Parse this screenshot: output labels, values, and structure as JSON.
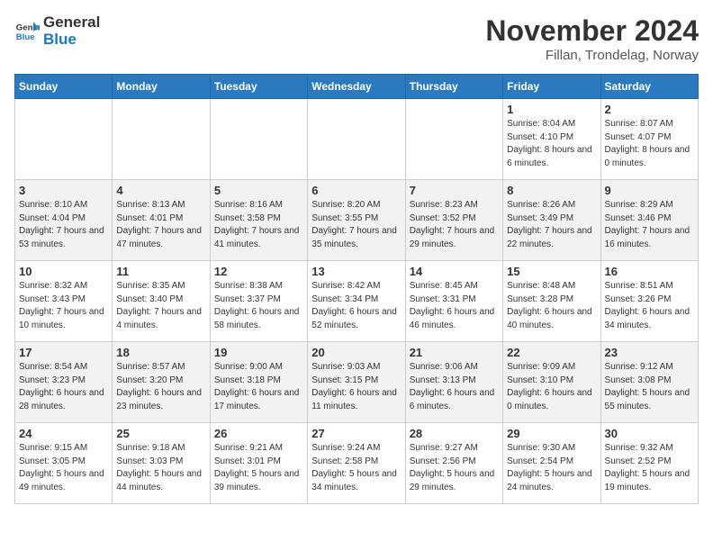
{
  "header": {
    "logo_general": "General",
    "logo_blue": "Blue",
    "month": "November 2024",
    "location": "Fillan, Trondelag, Norway"
  },
  "days_of_week": [
    "Sunday",
    "Monday",
    "Tuesday",
    "Wednesday",
    "Thursday",
    "Friday",
    "Saturday"
  ],
  "weeks": [
    [
      {
        "day": "",
        "info": ""
      },
      {
        "day": "",
        "info": ""
      },
      {
        "day": "",
        "info": ""
      },
      {
        "day": "",
        "info": ""
      },
      {
        "day": "",
        "info": ""
      },
      {
        "day": "1",
        "info": "Sunrise: 8:04 AM\nSunset: 4:10 PM\nDaylight: 8 hours and 6 minutes."
      },
      {
        "day": "2",
        "info": "Sunrise: 8:07 AM\nSunset: 4:07 PM\nDaylight: 8 hours and 0 minutes."
      }
    ],
    [
      {
        "day": "3",
        "info": "Sunrise: 8:10 AM\nSunset: 4:04 PM\nDaylight: 7 hours and 53 minutes."
      },
      {
        "day": "4",
        "info": "Sunrise: 8:13 AM\nSunset: 4:01 PM\nDaylight: 7 hours and 47 minutes."
      },
      {
        "day": "5",
        "info": "Sunrise: 8:16 AM\nSunset: 3:58 PM\nDaylight: 7 hours and 41 minutes."
      },
      {
        "day": "6",
        "info": "Sunrise: 8:20 AM\nSunset: 3:55 PM\nDaylight: 7 hours and 35 minutes."
      },
      {
        "day": "7",
        "info": "Sunrise: 8:23 AM\nSunset: 3:52 PM\nDaylight: 7 hours and 29 minutes."
      },
      {
        "day": "8",
        "info": "Sunrise: 8:26 AM\nSunset: 3:49 PM\nDaylight: 7 hours and 22 minutes."
      },
      {
        "day": "9",
        "info": "Sunrise: 8:29 AM\nSunset: 3:46 PM\nDaylight: 7 hours and 16 minutes."
      }
    ],
    [
      {
        "day": "10",
        "info": "Sunrise: 8:32 AM\nSunset: 3:43 PM\nDaylight: 7 hours and 10 minutes."
      },
      {
        "day": "11",
        "info": "Sunrise: 8:35 AM\nSunset: 3:40 PM\nDaylight: 7 hours and 4 minutes."
      },
      {
        "day": "12",
        "info": "Sunrise: 8:38 AM\nSunset: 3:37 PM\nDaylight: 6 hours and 58 minutes."
      },
      {
        "day": "13",
        "info": "Sunrise: 8:42 AM\nSunset: 3:34 PM\nDaylight: 6 hours and 52 minutes."
      },
      {
        "day": "14",
        "info": "Sunrise: 8:45 AM\nSunset: 3:31 PM\nDaylight: 6 hours and 46 minutes."
      },
      {
        "day": "15",
        "info": "Sunrise: 8:48 AM\nSunset: 3:28 PM\nDaylight: 6 hours and 40 minutes."
      },
      {
        "day": "16",
        "info": "Sunrise: 8:51 AM\nSunset: 3:26 PM\nDaylight: 6 hours and 34 minutes."
      }
    ],
    [
      {
        "day": "17",
        "info": "Sunrise: 8:54 AM\nSunset: 3:23 PM\nDaylight: 6 hours and 28 minutes."
      },
      {
        "day": "18",
        "info": "Sunrise: 8:57 AM\nSunset: 3:20 PM\nDaylight: 6 hours and 23 minutes."
      },
      {
        "day": "19",
        "info": "Sunrise: 9:00 AM\nSunset: 3:18 PM\nDaylight: 6 hours and 17 minutes."
      },
      {
        "day": "20",
        "info": "Sunrise: 9:03 AM\nSunset: 3:15 PM\nDaylight: 6 hours and 11 minutes."
      },
      {
        "day": "21",
        "info": "Sunrise: 9:06 AM\nSunset: 3:13 PM\nDaylight: 6 hours and 6 minutes."
      },
      {
        "day": "22",
        "info": "Sunrise: 9:09 AM\nSunset: 3:10 PM\nDaylight: 6 hours and 0 minutes."
      },
      {
        "day": "23",
        "info": "Sunrise: 9:12 AM\nSunset: 3:08 PM\nDaylight: 5 hours and 55 minutes."
      }
    ],
    [
      {
        "day": "24",
        "info": "Sunrise: 9:15 AM\nSunset: 3:05 PM\nDaylight: 5 hours and 49 minutes."
      },
      {
        "day": "25",
        "info": "Sunrise: 9:18 AM\nSunset: 3:03 PM\nDaylight: 5 hours and 44 minutes."
      },
      {
        "day": "26",
        "info": "Sunrise: 9:21 AM\nSunset: 3:01 PM\nDaylight: 5 hours and 39 minutes."
      },
      {
        "day": "27",
        "info": "Sunrise: 9:24 AM\nSunset: 2:58 PM\nDaylight: 5 hours and 34 minutes."
      },
      {
        "day": "28",
        "info": "Sunrise: 9:27 AM\nSunset: 2:56 PM\nDaylight: 5 hours and 29 minutes."
      },
      {
        "day": "29",
        "info": "Sunrise: 9:30 AM\nSunset: 2:54 PM\nDaylight: 5 hours and 24 minutes."
      },
      {
        "day": "30",
        "info": "Sunrise: 9:32 AM\nSunset: 2:52 PM\nDaylight: 5 hours and 19 minutes."
      }
    ]
  ]
}
